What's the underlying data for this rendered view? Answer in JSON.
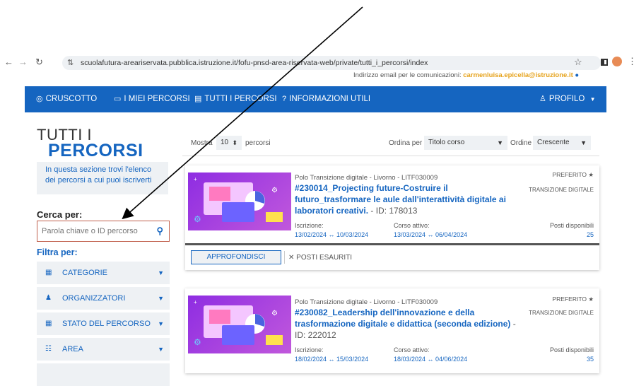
{
  "browser": {
    "back_icon": "back-arrow-icon",
    "forward_icon": "forward-arrow-icon",
    "reload_icon": "reload-icon",
    "url": "scuolafutura-areariservata.pubblica.istruzione.it/fofu-pnsd-area-riservata-web/private/tutti_i_percorsi/index"
  },
  "header": {
    "email_label": "Indirizzo email per le comunicazioni:",
    "email_value": "carmenluisa.epicella@istruzione.it"
  },
  "nav": {
    "cruscotto": "CRUSCOTTO",
    "miei_percorsi": "I MIEI PERCORSI",
    "tutti_percorsi": "TUTTI I PERCORSI",
    "info_utili": "INFORMAZIONI UTILI",
    "profilo": "PROFILO"
  },
  "sidebar": {
    "title_line1": "TUTTI I",
    "title_line2": "PERCORSI",
    "intro": "In questa sezione trovi l'elenco dei percorsi a cui puoi iscriverti",
    "cerca_label": "Cerca per:",
    "search_placeholder": "Parola chiave o ID percorso",
    "filtra_label": "Filtra per:",
    "filters": [
      "CATEGORIE",
      "ORGANIZZATORI",
      "STATO DEL PERCORSO",
      "AREA"
    ]
  },
  "controls": {
    "mostra": "Mostra",
    "per_page": "10",
    "percorsi": "percorsi",
    "ordina_per": "Ordina per",
    "sort_field": "Titolo corso",
    "ordine": "Ordine",
    "sort_order": "Crescente"
  },
  "cards": [
    {
      "org": "Polo Transizione digitale - Livorno - LITF030009",
      "title": "#230014_Projecting future-Costruire il futuro_trasformare le aule dall'interattività digitale ai laboratori creativi.",
      "id": " - ID: 178013",
      "preferito": "PREFERITO",
      "category": "TRANSIZIONE DIGITALE",
      "iscrizione_label": "Iscrizione:",
      "iscrizione": "13/02/2024 ↔ 10/03/2024",
      "corso_label": "Corso attivo:",
      "corso": "13/03/2024 ↔ 06/04/2024",
      "posti_label": "Posti disponibili",
      "posti": "25",
      "approfondisci": "APPROFONDISCI",
      "esauriti": "POSTI ESAURITI"
    },
    {
      "org": "Polo Transizione digitale - Livorno - LITF030009",
      "title": "#230082_Leadership dell'innovazione e della trasformazione digitale e didattica (seconda edizione)",
      "id": " - ID: 222012",
      "preferito": "PREFERITO",
      "category": "TRANSIZIONE DIGITALE",
      "iscrizione_label": "Iscrizione:",
      "iscrizione": "18/02/2024 ↔ 15/03/2024",
      "corso_label": "Corso attivo:",
      "corso": "18/03/2024 ↔ 04/06/2024",
      "posti_label": "Posti disponibili",
      "posti": "35"
    }
  ],
  "colors": {
    "nav_bg": "#1565c0",
    "accent": "#1565c0",
    "panel_bg": "#eef1f4",
    "search_border": "#c0604c",
    "email_highlight": "#e6a21a",
    "thumb_bg": "#8e2de2"
  }
}
